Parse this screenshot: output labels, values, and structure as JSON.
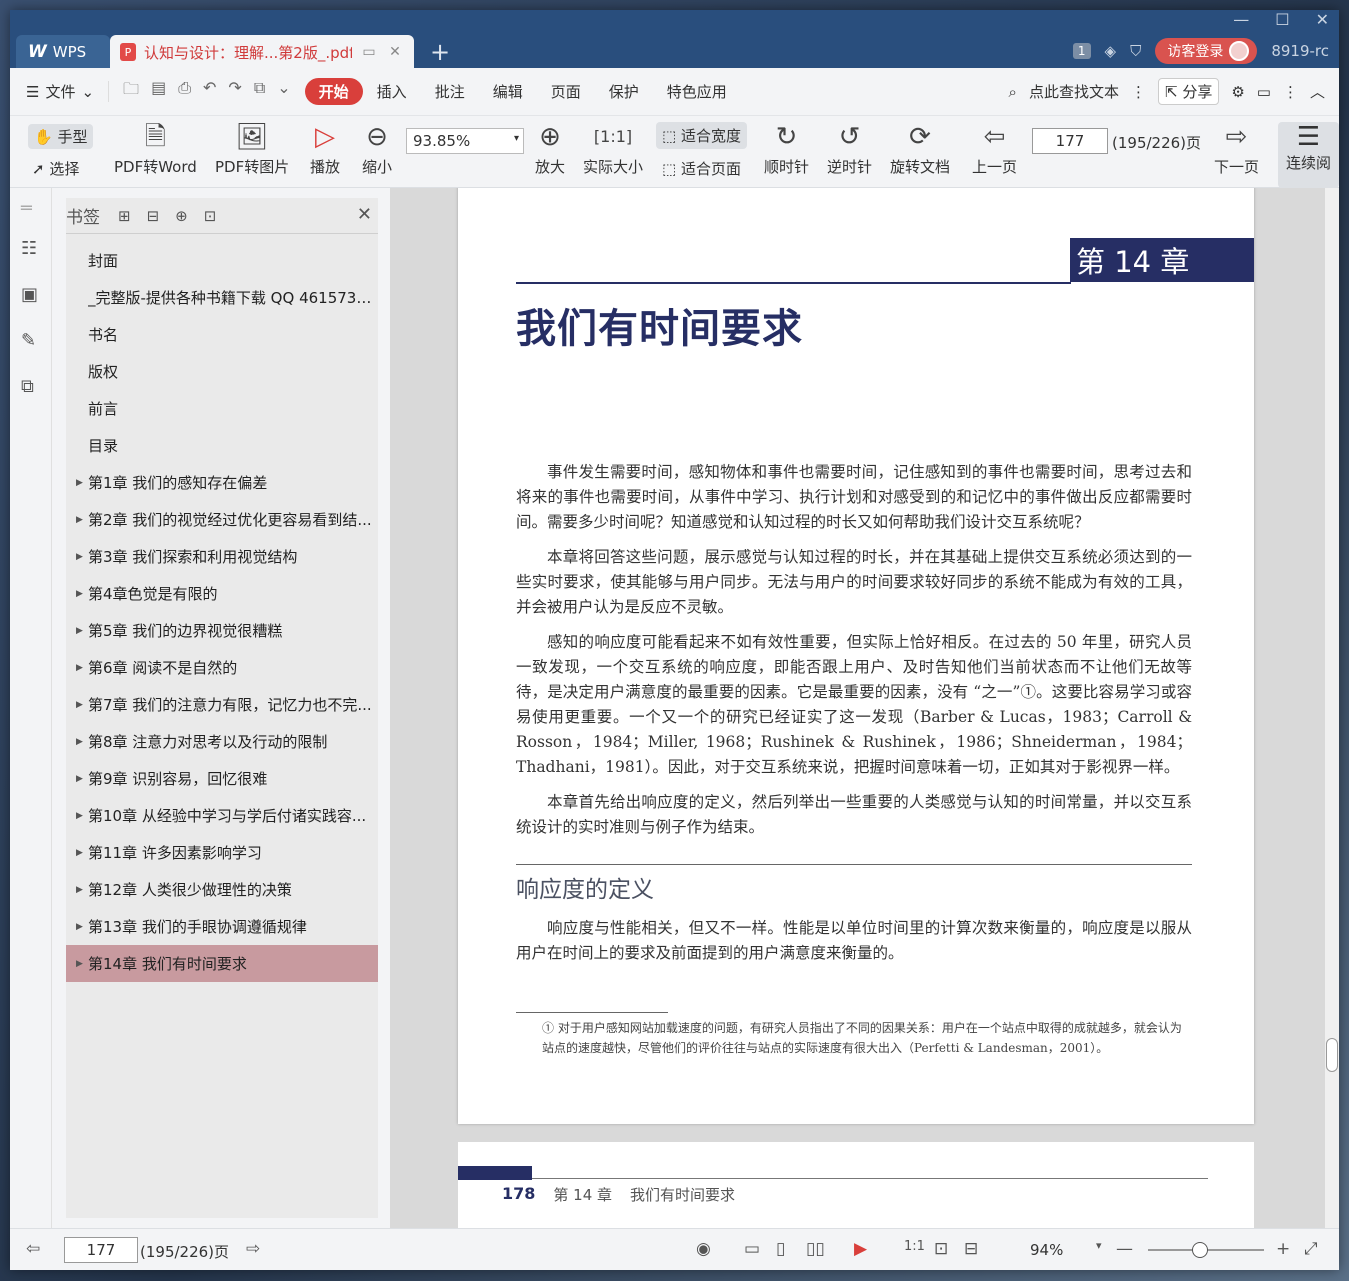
{
  "titlebar": {
    "app_label": "WPS",
    "doc_tab_title": "认知与设计：理解...第2版_.pdf",
    "page_badge": "1",
    "login_label": "访客登录",
    "user_id": "8919-rc"
  },
  "menubar": {
    "file_label": "文件",
    "tabs": [
      "开始",
      "插入",
      "批注",
      "编辑",
      "页面",
      "保护",
      "特色应用"
    ],
    "search_label": "点此查找文本",
    "share_label": "分享"
  },
  "toolbar": {
    "hand_label": "手型",
    "select_label": "选择",
    "pdf_to_word": "PDF转Word",
    "pdf_to_image": "PDF转图片",
    "play": "播放",
    "zoom_out": "缩小",
    "zoom_value": "93.85%",
    "zoom_in": "放大",
    "actual_size": "实际大小",
    "fit_width": "适合宽度",
    "fit_page": "适合页面",
    "clockwise": "顺时针",
    "counter_clockwise": "逆时针",
    "rotate_doc": "旋转文档",
    "prev_page": "上一页",
    "page_value": "177",
    "page_total": "(195/226)页",
    "next_page": "下一页",
    "continuous": "连续阅"
  },
  "bookmarks": {
    "title": "书签",
    "items": [
      {
        "label": "封面",
        "has_children": false
      },
      {
        "label": "_完整版-提供各种书籍下载 QQ 4615736...",
        "has_children": false
      },
      {
        "label": "书名",
        "has_children": false
      },
      {
        "label": "版权",
        "has_children": false
      },
      {
        "label": "前言",
        "has_children": false
      },
      {
        "label": "目录",
        "has_children": false
      },
      {
        "label": "第1章  我们的感知存在偏差",
        "has_children": true
      },
      {
        "label": "第2章  我们的视觉经过优化更容易看到结...",
        "has_children": true
      },
      {
        "label": "第3章  我们探索和利用视觉结构",
        "has_children": true
      },
      {
        "label": "第4章色觉是有限的",
        "has_children": true
      },
      {
        "label": "第5章  我们的边界视觉很糟糕",
        "has_children": true
      },
      {
        "label": "第6章  阅读不是自然的",
        "has_children": true
      },
      {
        "label": "第7章  我们的注意力有限，记忆力也不完...",
        "has_children": true
      },
      {
        "label": "第8章  注意力对思考以及行动的限制",
        "has_children": true
      },
      {
        "label": "第9章  识别容易，回忆很难",
        "has_children": true
      },
      {
        "label": "第10章  从经验中学习与学后付诸实践容...",
        "has_children": true
      },
      {
        "label": "第11章  许多因素影响学习",
        "has_children": true
      },
      {
        "label": "第12章  人类很少做理性的决策",
        "has_children": true
      },
      {
        "label": "第13章  我们的手眼协调遵循规律",
        "has_children": true
      },
      {
        "label": "第14章  我们有时间要求",
        "has_children": true,
        "selected": true
      }
    ]
  },
  "page": {
    "chapter_badge": "第 14 章",
    "chapter_title": "我们有时间要求",
    "paragraphs": [
      "事件发生需要时间，感知物体和事件也需要时间，记住感知到的事件也需要时间，思考过去和将来的事件也需要时间，从事件中学习、执行计划和对感受到的和记忆中的事件做出反应都需要时间。需要多少时间呢？知道感觉和认知过程的时长又如何帮助我们设计交互系统呢？",
      "本章将回答这些问题，展示感觉与认知过程的时长，并在其基础上提供交互系统必须达到的一些实时要求，使其能够与用户同步。无法与用户的时间要求较好同步的系统不能成为有效的工具，并会被用户认为是反应不灵敏。",
      "感知的响应度可能看起来不如有效性重要，但实际上恰好相反。在过去的 50 年里，研究人员一致发现，一个交互系统的响应度，即能否跟上用户、及时告知他们当前状态而不让他们无故等待，是决定用户满意度的最重要的因素。它是最重要的因素，没有 “之一”①。这要比容易学习或容易使用更重要。一个又一个的研究已经证实了这一发现（Barber & Lucas，1983；Carroll & Rosson，1984；Miller, 1968；Rushinek & Rushinek，1986；Shneiderman，1984；Thadhani，1981）。因此，对于交互系统来说，把握时间意味着一切，正如其对于影视界一样。",
      "本章首先给出响应度的定义，然后列举出一些重要的人类感觉与认知的时间常量，并以交互系统设计的实时准则与例子作为结束。"
    ],
    "section_title": "响应度的定义",
    "section_text": "响应度与性能相关，但又不一样。性能是以单位时间里的计算次数来衡量的，响应度是以服从用户在时间上的要求及前面提到的用户满意度来衡量的。",
    "footnote": "① 对于用户感知网站加载速度的问题，有研究人员指出了不同的因果关系：用户在一个站点中取得的成就越多，就会认为站点的速度越快，尽管他们的评价往往与站点的实际速度有很大出入（Perfetti & Landesman，2001）。",
    "next_page_number": "178",
    "next_page_chapter": "第 14 章",
    "next_page_title": "我们有时间要求"
  },
  "statusbar": {
    "page_value": "177",
    "page_total": "(195/226)页",
    "zoom_label": "94%"
  },
  "colors": {
    "title_bar": "#294e7d",
    "accent": "#d93f3b",
    "chapter_navy": "#262e64",
    "selected_bookmark": "#c89a9f"
  }
}
